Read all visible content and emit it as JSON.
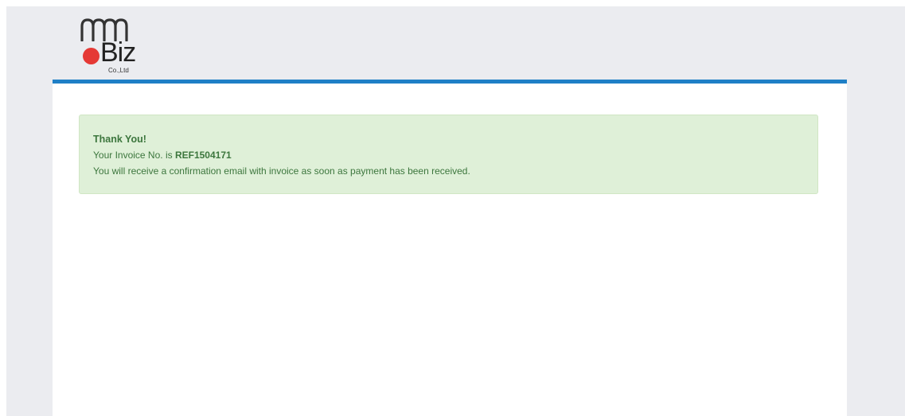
{
  "brand": {
    "logo_top": "mm",
    "logo_main": "Biz",
    "logo_sub": "Co.,Ltd",
    "dot_color": "#e53935",
    "accent_color": "#1f7fc6"
  },
  "alert": {
    "title": "Thank You!",
    "invoice_prefix": "Your Invoice No. is ",
    "invoice_number": "REF1504171",
    "message": "You will receive a confirmation email with invoice as soon as payment has been received."
  }
}
